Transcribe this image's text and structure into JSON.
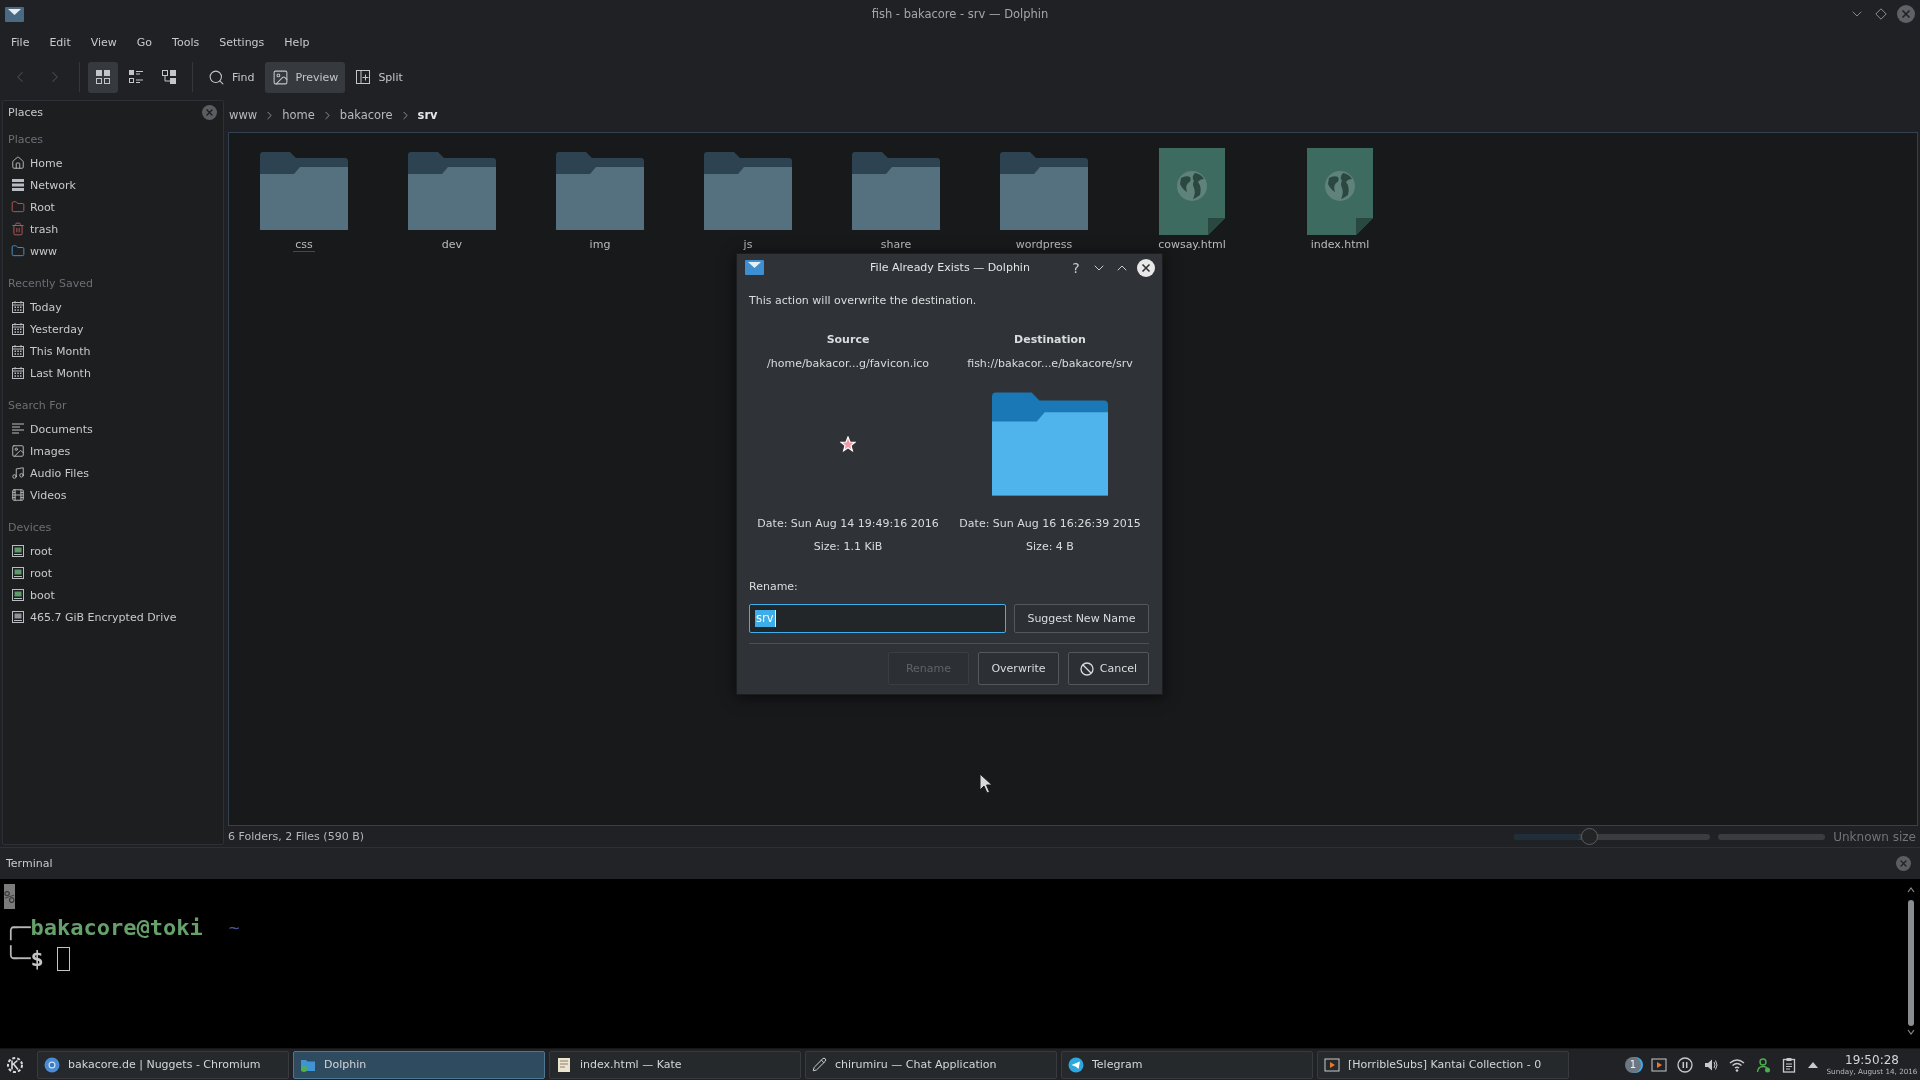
{
  "window": {
    "title": "fish - bakacore - srv — Dolphin"
  },
  "menu": [
    "File",
    "Edit",
    "View",
    "Go",
    "Tools",
    "Settings",
    "Help"
  ],
  "toolbar": {
    "navigation": [
      {
        "disabled": true
      },
      {
        "disabled": true
      }
    ],
    "view_modes": [
      {
        "selected": true
      },
      {
        "selected": false
      },
      {
        "selected": false
      }
    ],
    "actions": [
      {
        "label": "Find",
        "checked": false
      },
      {
        "label": "Preview",
        "checked": true
      },
      {
        "label": "Split",
        "checked": false
      }
    ]
  },
  "places_panel": {
    "title": "Places",
    "sections": [
      {
        "title": "Places",
        "items": [
          {
            "label": "Home",
            "selected": false
          },
          {
            "label": "Network",
            "selected": false
          },
          {
            "label": "Root",
            "selected": false
          },
          {
            "label": "trash",
            "selected": false
          },
          {
            "label": "www",
            "selected": false
          }
        ]
      },
      {
        "title": "Recently Saved",
        "items": [
          {
            "label": "Today",
            "selected": false
          },
          {
            "label": "Yesterday",
            "selected": false
          },
          {
            "label": "This Month",
            "selected": false
          },
          {
            "label": "Last Month",
            "selected": false
          }
        ]
      },
      {
        "title": "Search For",
        "items": [
          {
            "label": "Documents",
            "selected": false
          },
          {
            "label": "Images",
            "selected": false
          },
          {
            "label": "Audio Files",
            "selected": false
          },
          {
            "label": "Videos",
            "selected": false
          }
        ]
      },
      {
        "title": "Devices",
        "items": [
          {
            "label": "root",
            "selected": false
          },
          {
            "label": "root",
            "selected": false
          },
          {
            "label": "boot",
            "selected": false
          },
          {
            "label": "465.7 GiB Encrypted Drive",
            "selected": false
          }
        ]
      }
    ]
  },
  "breadcrumb": [
    {
      "label": "www",
      "selected": false
    },
    {
      "label": "home",
      "selected": false
    },
    {
      "label": "bakacore",
      "selected": false
    },
    {
      "label": "srv",
      "selected": true
    }
  ],
  "files": [
    {
      "name": "css",
      "kind": "folder",
      "focused": true
    },
    {
      "name": "dev",
      "kind": "folder",
      "focused": false
    },
    {
      "name": "img",
      "kind": "folder",
      "focused": false
    },
    {
      "name": "js",
      "kind": "folder",
      "focused": false
    },
    {
      "name": "share",
      "kind": "folder",
      "focused": false
    },
    {
      "name": "wordpress",
      "kind": "folder",
      "focused": false
    },
    {
      "name": "cowsay.html",
      "kind": "web_page",
      "focused": false
    },
    {
      "name": "index.html",
      "kind": "web_page",
      "focused": false
    }
  ],
  "status_bar": {
    "summary": "6 Folders, 2 Files (590 B)",
    "zoom": {
      "level": 0.38
    },
    "free_space": "Unknown size"
  },
  "dialog": {
    "title": "File Already Exists — Dolphin",
    "help": "?",
    "message": "This action will overwrite the destination.",
    "columns": [
      {
        "heading": "Source",
        "path": "/home/bakacor...g/favicon.ico",
        "kind": "image",
        "date": "Date: Sun Aug 14 19:49:16 2016",
        "size": "Size: 1.1 KiB"
      },
      {
        "heading": "Destination",
        "path": "fish://bakacor...e/bakacore/srv",
        "kind": "folder",
        "date": "Date: Sun Aug 16 16:26:39 2015",
        "size": "Size: 4 B"
      }
    ],
    "rename": {
      "label": "Rename:",
      "value": "srv",
      "text_selected": true
    },
    "suggest_button": "Suggest New Name",
    "buttons": [
      {
        "label": "Rename",
        "disabled": true
      },
      {
        "label": "Overwrite",
        "disabled": false
      },
      {
        "label": "Cancel",
        "disabled": false
      }
    ]
  },
  "terminal": {
    "title": "Terminal",
    "line_mark": "%",
    "prompt": {
      "corner_top": "╭─",
      "user_host": "bakacore@toki",
      "directory": "~",
      "corner_bottom": "╰─",
      "symbol": "$"
    }
  },
  "taskbar": {
    "tasks": [
      {
        "label": "bakacore.de | Nuggets - Chromium",
        "selected": false
      },
      {
        "label": "Dolphin",
        "selected": true
      },
      {
        "label": "index.html — Kate",
        "selected": false
      },
      {
        "label": "chirumiru — Chat Application",
        "selected": false
      },
      {
        "label": "Telegram",
        "selected": false
      },
      {
        "label": "[HorribleSubs] Kantai Collection - 0",
        "selected": false
      }
    ],
    "tray_badge": "1",
    "clock": {
      "time": "19:50:28",
      "date": "Sunday, August 14, 2016"
    }
  }
}
